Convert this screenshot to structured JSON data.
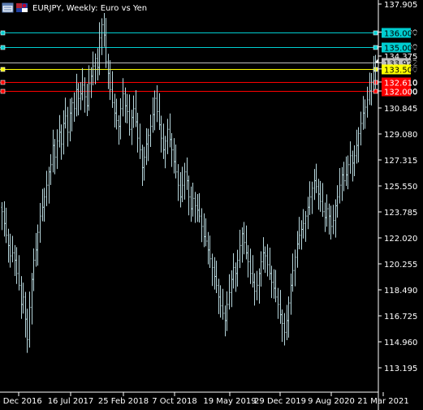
{
  "header": {
    "title": "EURJPY, Weekly:  Euro vs Yen"
  },
  "colors": {
    "background": "#000000",
    "bars": "#b6d6dc",
    "axis": "#ffffff",
    "cyan": "#00ced1",
    "silver": "#c0c0c0",
    "yellow": "#ffff00",
    "red": "#ff0000"
  },
  "chart_data": {
    "type": "ohlc",
    "title": "EURJPY, Weekly:  Euro vs Yen",
    "xlabel": "",
    "ylabel": "",
    "ylim": [
      112.1,
      139.0
    ],
    "grid": false,
    "y_ticks": [
      "137.905",
      "136.000",
      "135.000",
      "134.375",
      "133.922",
      "133.500",
      "132.610",
      "132.000",
      "130.845",
      "129.080",
      "127.315",
      "125.550",
      "123.785",
      "122.020",
      "120.255",
      "118.490",
      "116.725",
      "114.960",
      "113.195"
    ],
    "x_ticks": [
      "4 Dec 2016",
      "16 Jul 2017",
      "25 Feb 2018",
      "7 Oct 2018",
      "19 May 2019",
      "29 Dec 2019",
      "9 Aug 2020",
      "21 Mar 2021"
    ],
    "levels": [
      {
        "value": 136.0,
        "label": "136.000",
        "color": "#00ced1",
        "marker": "left"
      },
      {
        "value": 135.0,
        "label": "135.000",
        "color": "#00ced1",
        "marker": "left"
      },
      {
        "value": 133.922,
        "label": "133.922",
        "color": "#c0c0c0",
        "marker": "none"
      },
      {
        "value": 133.5,
        "label": "133.500",
        "color": "#ffff00",
        "marker": "left"
      },
      {
        "value": 132.61,
        "label": "132.610",
        "color": "#ff0000",
        "marker": "left"
      },
      {
        "value": 132.0,
        "label": "132.000",
        "color": "#ff0000",
        "marker": "left"
      }
    ],
    "series": [
      {
        "close": [
          123.8,
          123.0,
          122.2,
          121.5,
          120.8,
          121.0,
          120.5,
          119.6,
          118.8,
          117.5,
          118.0,
          116.5,
          115.1,
          117.3,
          119.2,
          120.5,
          121.2,
          122.4,
          123.5,
          124.1,
          124.8,
          125.6,
          126.5,
          127.0,
          128.3,
          127.5,
          128.6,
          129.2,
          128.4,
          129.8,
          130.3,
          129.2,
          130.5,
          131.2,
          130.8,
          132.1,
          131.5,
          131.8,
          132.4,
          131.6,
          131.0,
          132.5,
          133.0,
          133.7,
          134.2,
          133.6,
          135.6,
          136.5,
          135.8,
          134.0,
          133.2,
          132.1,
          131.2,
          130.5,
          130.0,
          129.6,
          130.8,
          131.8,
          131.0,
          130.6,
          129.4,
          130.2,
          130.8,
          129.9,
          128.8,
          128.0,
          126.8,
          127.5,
          128.4,
          129.0,
          129.6,
          130.4,
          131.5,
          130.6,
          129.7,
          128.8,
          128.0,
          128.6,
          129.4,
          128.7,
          128.0,
          127.2,
          126.5,
          125.6,
          124.8,
          125.6,
          126.5,
          125.9,
          124.8,
          124.0,
          124.7,
          124.2,
          123.9,
          123.5,
          122.8,
          122.1,
          121.8,
          121.2,
          120.6,
          120.0,
          119.4,
          118.8,
          118.0,
          117.4,
          116.9,
          116.4,
          117.5,
          118.3,
          119.2,
          120.0,
          119.6,
          120.5,
          121.5,
          122.3,
          121.7,
          121.0,
          120.4,
          119.6,
          119.0,
          118.4,
          118.8,
          119.6,
          120.4,
          121.0,
          120.8,
          120.2,
          119.6,
          119.0,
          118.6,
          118.0,
          117.5,
          116.8,
          116.2,
          115.6,
          116.4,
          117.6,
          118.8,
          119.8,
          120.7,
          121.6,
          122.2,
          122.6,
          123.0,
          123.5,
          124.1,
          124.8,
          125.4,
          125.9,
          125.5,
          125.0,
          124.5,
          123.8,
          123.4,
          124.0,
          123.5,
          122.8,
          123.2,
          124.2,
          124.8,
          125.6,
          126.3,
          125.9,
          126.3,
          127.0,
          127.6,
          127.1,
          127.6,
          128.3,
          129.1,
          129.8,
          130.5,
          130.9,
          131.4,
          132.0,
          132.6,
          133.4,
          134.1
        ]
      }
    ]
  }
}
